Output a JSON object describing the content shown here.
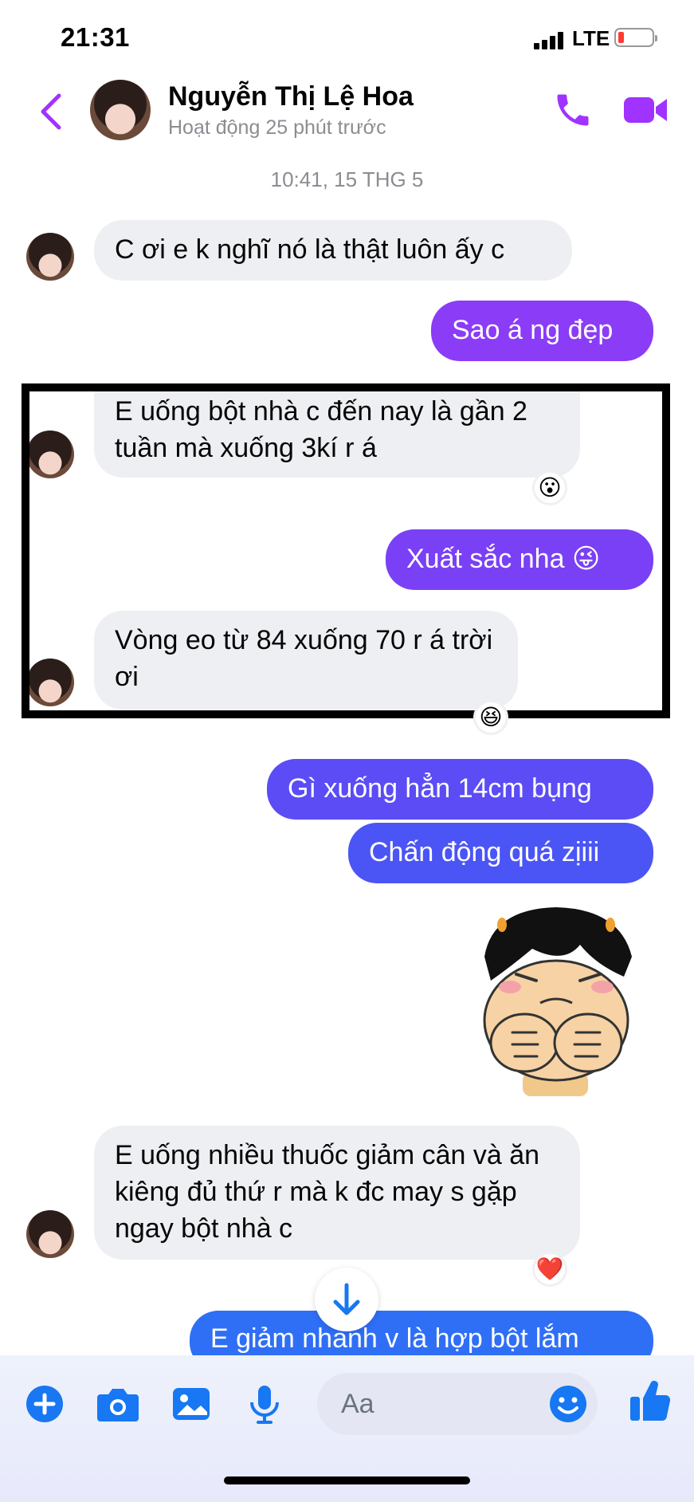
{
  "status_bar": {
    "time": "21:31",
    "network": "LTE"
  },
  "header": {
    "contact_name": "Nguyễn Thị Lệ Hoa",
    "contact_status": "Hoạt động 25 phút trước"
  },
  "chat": {
    "timestamp": "10:41, 15 THG 5",
    "messages": [
      {
        "text": "C ơi e k nghĩ nó là thật luôn ấy c"
      },
      {
        "text": "Sao á ng đẹp"
      },
      {
        "text": "E uống bột nhà c đến nay là gần 2 tuần mà xuống 3kí r á",
        "reaction": "😮"
      },
      {
        "text": "Xuất sắc nha 😜"
      },
      {
        "text": "Vòng eo từ 84 xuống 70 r á trời ơi",
        "reaction": "😆"
      },
      {
        "text": "Gì xuống hẳn 14cm bụng"
      },
      {
        "text": "Chấn động quá zịiii"
      },
      {
        "text": "E uống nhiều thuốc giảm cân và ăn kiêng đủ thứ r mà k đc may s gặp ngay bột nhà c",
        "reaction": "❤️"
      },
      {
        "text": "E giảm nhanh v là hợp bột lắm"
      }
    ]
  },
  "composer": {
    "placeholder": "Aa"
  },
  "colors": {
    "accent": "#a033ff",
    "incoming_bubble": "#eeeff2",
    "outgoing_purple": "#8b3cf7",
    "outgoing_indigo": "#5b4cf5",
    "outgoing_blue": "#2f6ff6",
    "composer_icon": "#1877f2"
  },
  "icons": [
    "back-chevron-icon",
    "phone-icon",
    "video-camera-icon",
    "plus-icon",
    "camera-icon",
    "gallery-icon",
    "microphone-icon",
    "emoji-icon",
    "thumbs-up-icon",
    "arrow-down-icon"
  ]
}
